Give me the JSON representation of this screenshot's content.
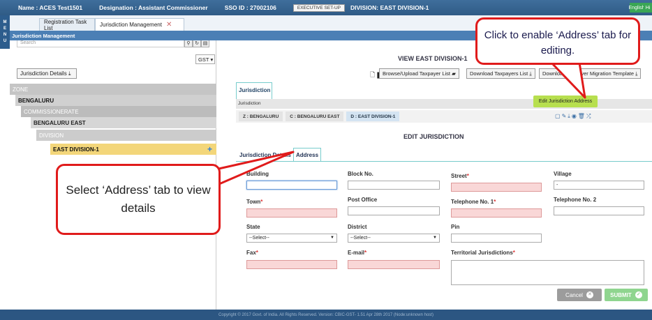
{
  "topbar": {
    "name": "Name : ACES Test1501",
    "designation": "Designation : Assistant Commissioner",
    "sso": "SSO ID : 27002106",
    "exec_setup": "EXECUTIVE SET-UP",
    "division": "DIVISION:  EAST DIVISION-1",
    "lang_en": "English",
    "lang_hi": "Hi"
  },
  "menu": {
    "label": "MENU"
  },
  "tabs": [
    {
      "label": "Registration Task List"
    },
    {
      "label": "Jurisdiction Management"
    }
  ],
  "subbar": {
    "title": "Jurisdiction Management"
  },
  "left": {
    "search_placeholder": "Search",
    "gst_select": "GST",
    "jd_button": "Jurisdiction Details",
    "tree": {
      "zone": "ZONE",
      "bengaluru": "BENGALURU",
      "commissionerate": "COMMISSIONERATE",
      "bengaluru_east": "BENGALURU EAST",
      "division": "DIVISION",
      "east_division_1": "EAST DIVISION-1"
    }
  },
  "main": {
    "view_title": "VIEW EAST DIVISION-1",
    "browse_btn": "Browse/Upload Taxpayer List",
    "download_list_btn": "Download Taxpayers List",
    "download_template_btn": "Download Taxpayer Migration Template",
    "jurisdiction_tab": "Jurisdiction",
    "jurisdiction_strip": "Jurisdiction",
    "crumbs": [
      "Z : BENGALURU",
      "C : BENGALURU EAST",
      "D : EAST DIVISION-1"
    ],
    "tooltip": "Edit Jurisdiction Address",
    "edit_title": "EDIT JURISDICTION",
    "form_tabs": [
      "Jurisdiction Details",
      "Address"
    ],
    "fields": {
      "building": "Building",
      "block_no": "Block No.",
      "street": "Street",
      "village": "Village",
      "village_value": "-",
      "town": "Town",
      "post_office": "Post Office",
      "telephone1": "Telephone No. 1",
      "telephone2": "Telephone No. 2",
      "state": "State",
      "district": "District",
      "pin": "Pin",
      "state_value": "--Select--",
      "district_value": "--Select--",
      "fax": "Fax",
      "email": "E-mail",
      "territorial": "Territorial Jurisdictions",
      "required_mark": "*"
    },
    "cancel_btn": "Cancel",
    "submit_btn": "SUBMIT"
  },
  "footer": {
    "text": "Copyright © 2017 Govt. of India. All Rights Reserved. Version: CBIC-GST- 1.51 Apr 28th 2017    (Node:unknown host)"
  },
  "callouts": {
    "top_right": "Click to enable ‘Address’ tab for editing.",
    "left": "Select ‘Address’ tab to view details"
  },
  "colors": {
    "accent": "#2f5b86",
    "callout_border": "#e01b1b",
    "error_field": "#f9d7d7",
    "tree_selected": "#f3d67a"
  }
}
